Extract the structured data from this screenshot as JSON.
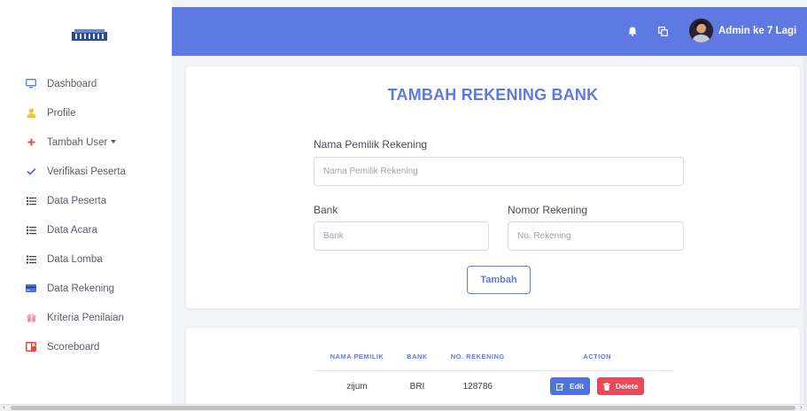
{
  "colors": {
    "primary": "#5f79e3",
    "danger": "#e74a5b",
    "edit": "#4e73df"
  },
  "sidebar": {
    "items": [
      {
        "label": "Dashboard",
        "icon": "monitor-icon"
      },
      {
        "label": "Profile",
        "icon": "user-icon"
      },
      {
        "label": "Tambah User",
        "icon": "plus-icon"
      },
      {
        "label": "Verifikasi Peserta",
        "icon": "check-icon"
      },
      {
        "label": "Data Peserta",
        "icon": "list-icon"
      },
      {
        "label": "Data Acara",
        "icon": "list-icon"
      },
      {
        "label": "Data Lomba",
        "icon": "list-icon"
      },
      {
        "label": "Data Rekening",
        "icon": "credit-card-icon"
      },
      {
        "label": "Kriteria Penilaian",
        "icon": "gift-icon"
      },
      {
        "label": "Scoreboard",
        "icon": "scoreboard-icon"
      }
    ]
  },
  "topbar": {
    "user_name": "Admin ke 7 Lagi"
  },
  "form": {
    "title": "TAMBAH REKENING BANK",
    "nama_label": "Nama Pemilik Rekening",
    "nama_placeholder": "Nama Pemilik Rekening",
    "bank_label": "Bank",
    "bank_placeholder": "Bank",
    "nomor_label": "Nomor Rekening",
    "nomor_placeholder": "No. Rekening",
    "submit_label": "Tambah"
  },
  "table": {
    "headers": [
      "NAMA PEMILIK",
      "BANK",
      "NO. REKENING",
      "ACTION"
    ],
    "rows": [
      {
        "nama": "zijum",
        "bank": "BRI",
        "no_rekening": "128786"
      }
    ],
    "edit_label": "Edit",
    "delete_label": "Delete"
  }
}
